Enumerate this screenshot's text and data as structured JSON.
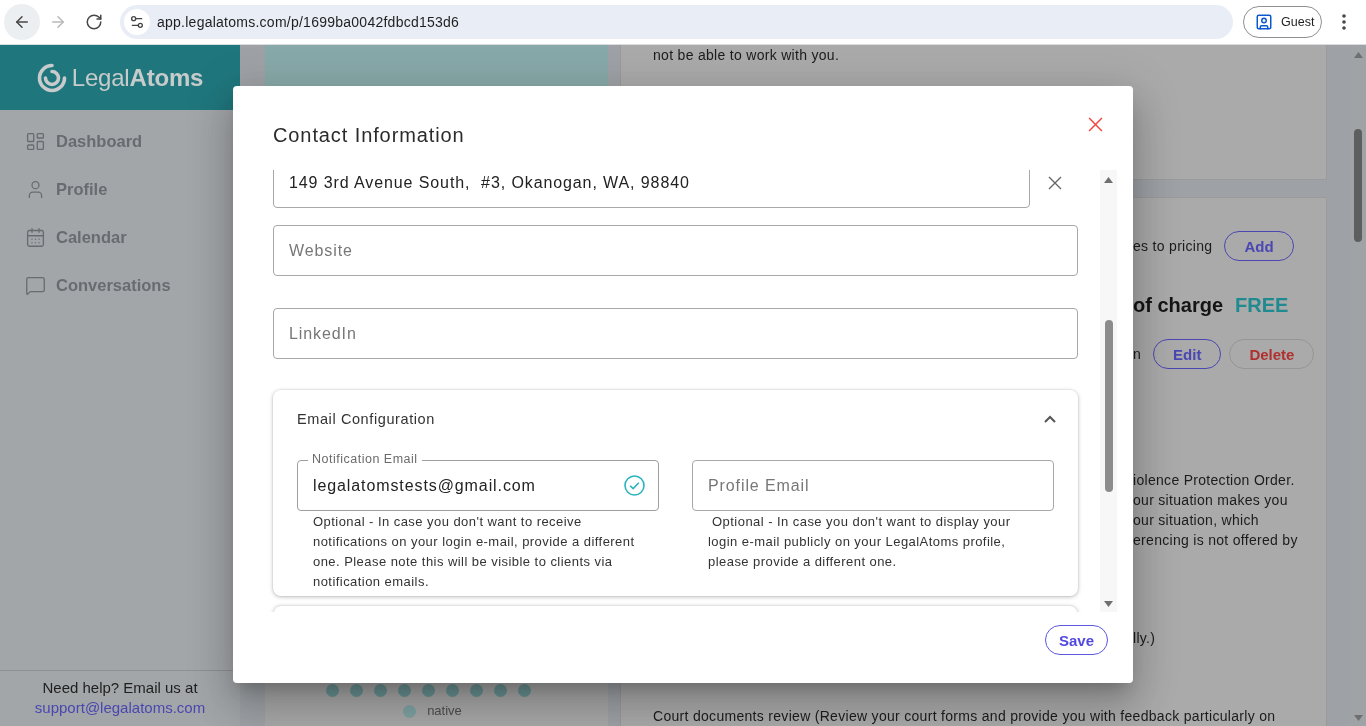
{
  "browser": {
    "nav": [
      {
        "kind": "back",
        "disabled": false,
        "highlighted": true
      },
      {
        "kind": "forward",
        "disabled": true,
        "highlighted": false
      },
      {
        "kind": "reload",
        "disabled": false,
        "highlighted": false
      }
    ],
    "url": "app.legalatoms.com/p/1699ba0042fdbcd153d6",
    "profile": "Guest"
  },
  "sidebar": {
    "logo": "Legal**Atoms**",
    "items": [
      {
        "kind": "dashboard",
        "label": "Dashboard",
        "selected": false
      },
      {
        "kind": "profile",
        "label": "Profile",
        "selected": false
      },
      {
        "kind": "calendar",
        "label": "Calendar",
        "selected": false
      },
      {
        "kind": "conversations",
        "label": "Conversations",
        "selected": false
      }
    ],
    "help_text": "Need help? Email us at",
    "help_link": "support@legalatoms.com"
  },
  "middle_panel": {
    "legend": "native"
  },
  "right_panel": {
    "intro": "not be able to work with you.",
    "pricing_text": "es to pricing",
    "add_button": "Add",
    "price_label": "of charge",
    "price_value": "FREE",
    "service_text": "n",
    "edit_button": "Edit",
    "delete_button": "Delete",
    "description": [
      "iolence Protection Order.",
      "our situation makes you",
      "our situation, which",
      "erencing is not offered by"
    ],
    "note": "lly.)",
    "service_title": "Court documents review (Review your court forms and provide you with feedback particularly on"
  },
  "dialog": {
    "title": "Contact Information",
    "fields": [
      {
        "kind": "address",
        "value": "149 3rd Avenue South,  #3, Okanogan, WA, 98840"
      },
      {
        "kind": "plain",
        "placeholder": "Website"
      },
      {
        "kind": "plain",
        "placeholder": "LinkedIn"
      }
    ],
    "email_configuration": {
      "title": "Email Configuration",
      "expanded": true,
      "fields": [
        {
          "label": "Notification Email",
          "value": "legalatomstests@gmail.com",
          "valid": true,
          "helper": "Optional - In case you don't want to receive notifications on your login e-mail, provide a different one. Please note this will be visible to clients via notification emails."
        },
        {
          "placeholder": "Profile Email",
          "valid": false,
          "helper": " Optional - In case you don't want to display your login e-mail publicly on your LegalAtoms profile, please provide a different one."
        }
      ]
    },
    "save_button": "Save"
  }
}
